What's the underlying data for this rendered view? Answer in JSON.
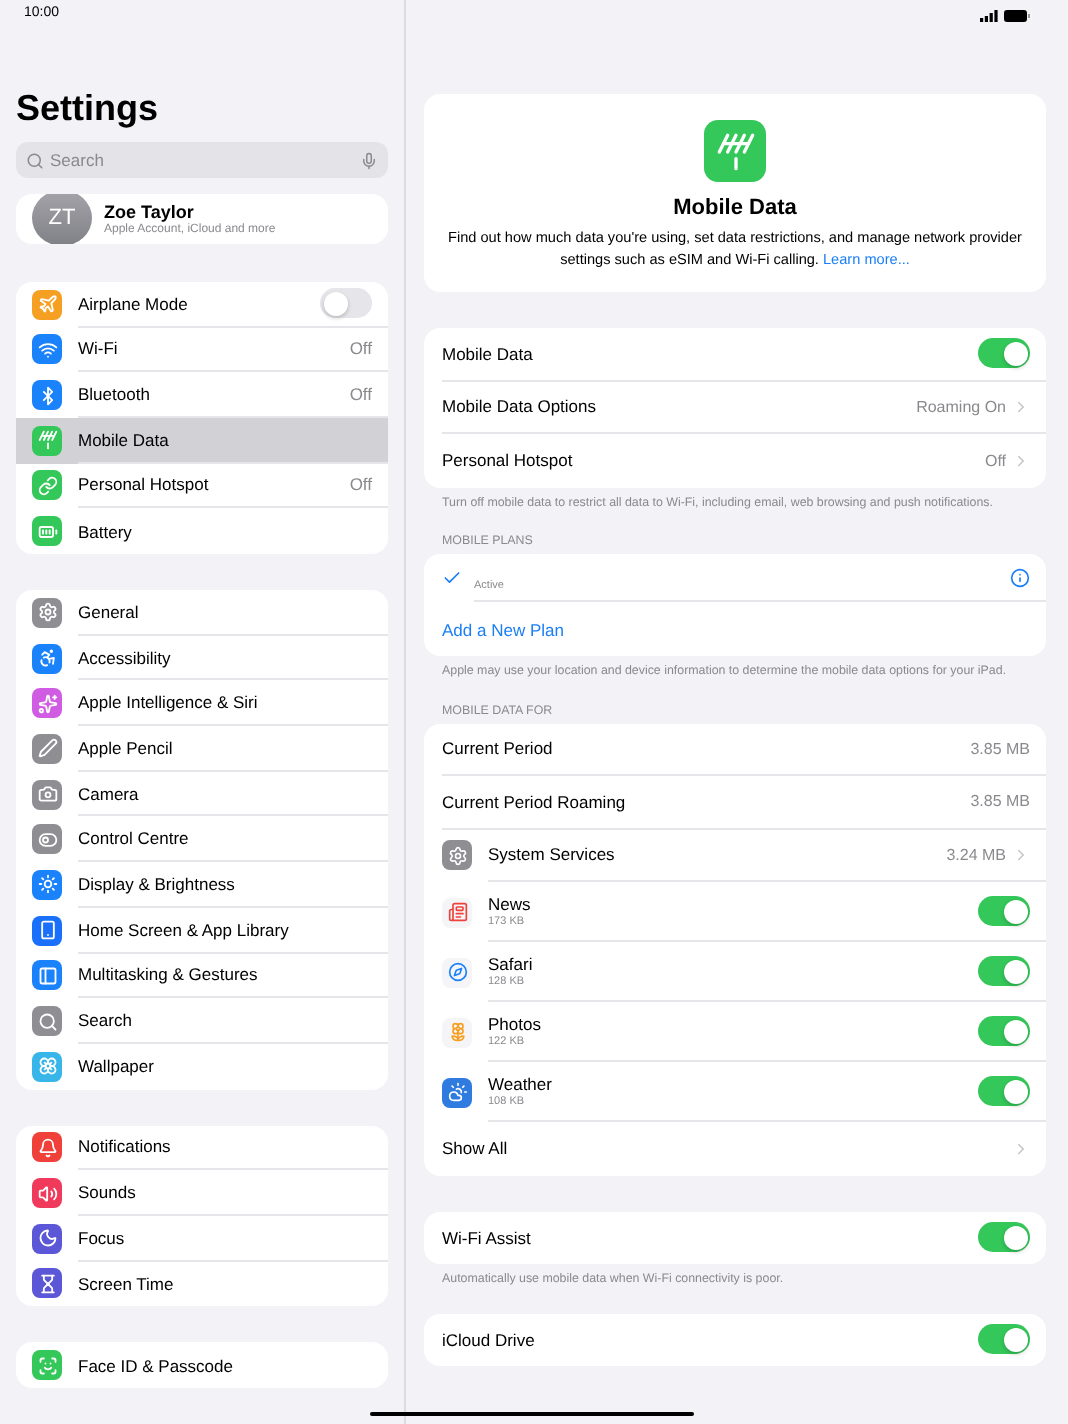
{
  "status_bar": {
    "time": "10:00"
  },
  "sidebar": {
    "title": "Settings",
    "search": {
      "placeholder": "Search"
    },
    "profile": {
      "initials": "ZT",
      "name": "Zoe Taylor",
      "subtitle": "Apple Account, iCloud and more"
    },
    "groups": [
      [
        {
          "label": "Airplane Mode",
          "kind": "toggle",
          "on": false,
          "selected": false,
          "color": "#f6a023"
        },
        {
          "label": "Wi-Fi",
          "kind": "value",
          "value": "Off",
          "selected": false,
          "color": "#1a82fb"
        },
        {
          "label": "Bluetooth",
          "kind": "value",
          "value": "Off",
          "selected": false,
          "color": "#1a82fb"
        },
        {
          "label": "Mobile Data",
          "kind": "plain",
          "selected": true,
          "color": "#34c759"
        },
        {
          "label": "Personal Hotspot",
          "kind": "value",
          "value": "Off",
          "selected": false,
          "color": "#34c759"
        },
        {
          "label": "Battery",
          "kind": "plain",
          "selected": false,
          "color": "#34c759"
        }
      ],
      [
        {
          "label": "General",
          "kind": "plain",
          "selected": false,
          "color": "#8e8e93"
        },
        {
          "label": "Accessibility",
          "kind": "plain",
          "selected": false,
          "color": "#1a82fb"
        },
        {
          "label": "Apple Intelligence & Siri",
          "kind": "plain",
          "selected": false,
          "color": "#d05ce3"
        },
        {
          "label": "Apple Pencil",
          "kind": "plain",
          "selected": false,
          "color": "#8e8e93"
        },
        {
          "label": "Camera",
          "kind": "plain",
          "selected": false,
          "color": "#8e8e93"
        },
        {
          "label": "Control Centre",
          "kind": "plain",
          "selected": false,
          "color": "#8e8e93"
        },
        {
          "label": "Display & Brightness",
          "kind": "plain",
          "selected": false,
          "color": "#1a82fb"
        },
        {
          "label": "Home Screen & App Library",
          "kind": "plain",
          "selected": false,
          "color": "#1a6ffb"
        },
        {
          "label": "Multitasking & Gestures",
          "kind": "plain",
          "selected": false,
          "color": "#1a82fb"
        },
        {
          "label": "Search",
          "kind": "plain",
          "selected": false,
          "color": "#8e8e93"
        },
        {
          "label": "Wallpaper",
          "kind": "plain",
          "selected": false,
          "color": "#38b6ea"
        }
      ],
      [
        {
          "label": "Notifications",
          "kind": "plain",
          "selected": false,
          "color": "#f0403a"
        },
        {
          "label": "Sounds",
          "kind": "plain",
          "selected": false,
          "color": "#f03a5c"
        },
        {
          "label": "Focus",
          "kind": "plain",
          "selected": false,
          "color": "#5b57d6"
        },
        {
          "label": "Screen Time",
          "kind": "plain",
          "selected": false,
          "color": "#5b57d6"
        }
      ],
      [
        {
          "label": "Face ID & Passcode",
          "kind": "plain",
          "selected": false,
          "color": "#34c759"
        }
      ]
    ]
  },
  "detail": {
    "header": {
      "title": "Mobile Data",
      "description": "Find out how much data you're using, set data restrictions, and manage network provider settings such as eSIM and Wi-Fi calling.",
      "link": "Learn more..."
    },
    "main_rows": [
      {
        "label": "Mobile Data",
        "kind": "toggle",
        "on": true
      },
      {
        "label": "Mobile Data Options",
        "kind": "link",
        "value": "Roaming On"
      },
      {
        "label": "Personal Hotspot",
        "kind": "link",
        "value": "Off"
      }
    ],
    "main_footer": "Turn off mobile data to restrict all data to Wi-Fi, including email, web browsing and push notifications.",
    "plans": {
      "header": "MOBILE PLANS",
      "plan_status": "Active",
      "checked": true,
      "add_label": "Add a New Plan",
      "footer": "Apple may use your location and device information to determine the mobile data options for your iPad."
    },
    "usage": {
      "header": "MOBILE DATA FOR",
      "rows": [
        {
          "label": "Current Period",
          "kind": "value",
          "value": "3.85 MB"
        },
        {
          "label": "Current Period Roaming",
          "kind": "value",
          "value": "3.85 MB"
        },
        {
          "label": "System Services",
          "kind": "app_link",
          "value": "3.24 MB",
          "color": "#8e8e93"
        },
        {
          "label": "News",
          "kind": "app",
          "detail": "173 KB",
          "on": true,
          "color": "#f5f5f7"
        },
        {
          "label": "Safari",
          "kind": "app",
          "detail": "128 KB",
          "on": true,
          "color": "#f5f5f7"
        },
        {
          "label": "Photos",
          "kind": "app",
          "detail": "122 KB",
          "on": true,
          "color": "#f5f5f7"
        },
        {
          "label": "Weather",
          "kind": "app",
          "detail": "108 KB",
          "on": true,
          "color": "#2f7be0"
        },
        {
          "label": "Show All",
          "kind": "link"
        }
      ]
    },
    "wifi_assist": {
      "label": "Wi-Fi Assist",
      "on": true,
      "footer": "Automatically use mobile data when Wi-Fi connectivity is poor."
    },
    "icloud": {
      "label": "iCloud Drive",
      "on": true
    }
  }
}
